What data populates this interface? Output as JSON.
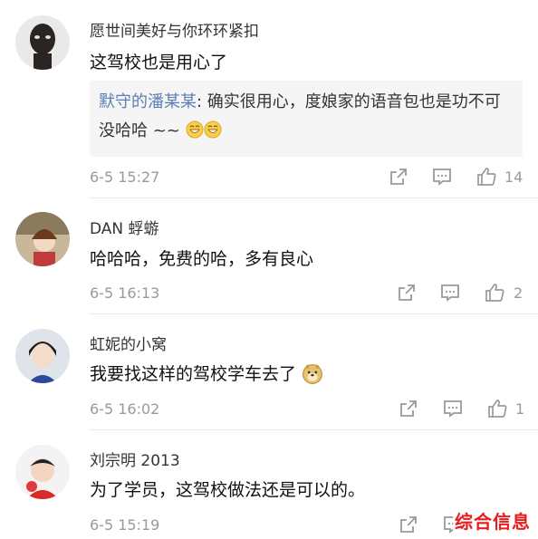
{
  "comments": [
    {
      "username": "愿世间美好与你环环紧扣",
      "text": "这驾校也是用心了",
      "reply": {
        "name": "默守的潘某某",
        "text": ": 确实很用心，度娘家的语音包也是功不可没哈哈 ~~"
      },
      "time": "6-5 15:27",
      "likes": "14"
    },
    {
      "username": "DAN 蜉蝣",
      "text": "哈哈哈，免费的哈，多有良心",
      "time": "6-5 16:13",
      "likes": "2"
    },
    {
      "username": "虹妮的小窝",
      "text": "我要找这样的驾校学车去了",
      "time": "6-5 16:02",
      "likes": "1"
    },
    {
      "username": "刘宗明 2013",
      "text": "为了学员，这驾校做法还是可以的。",
      "time": "6-5 15:19",
      "likes": ""
    }
  ],
  "watermark": "综合信息",
  "icons": [
    "share-icon",
    "comment-icon",
    "like-icon",
    "grin-emoji-icon",
    "doge-emoji-icon"
  ]
}
